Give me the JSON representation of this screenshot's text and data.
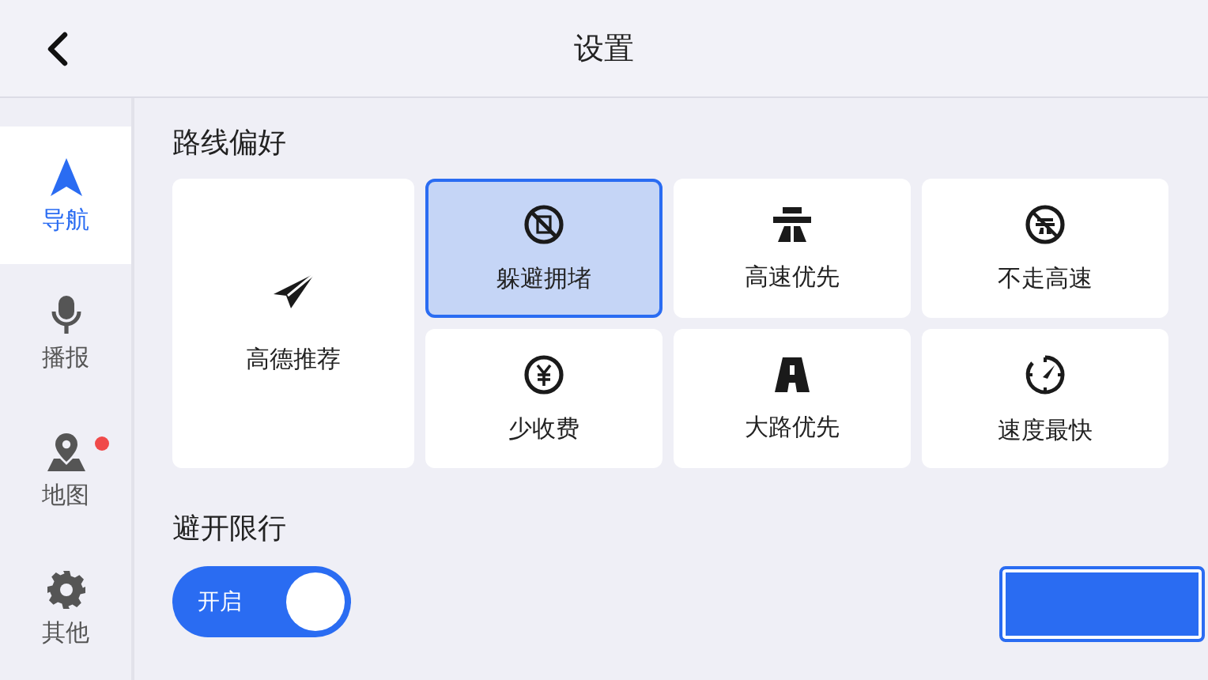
{
  "header": {
    "title": "设置"
  },
  "sidebar": {
    "items": [
      {
        "label": "导航",
        "selected": true,
        "badge": false
      },
      {
        "label": "播报",
        "selected": false,
        "badge": false
      },
      {
        "label": "地图",
        "selected": false,
        "badge": true
      },
      {
        "label": "其他",
        "selected": false,
        "badge": false
      }
    ]
  },
  "route_preferences": {
    "title": "路线偏好",
    "options": [
      {
        "label": "高德推荐",
        "selected": false
      },
      {
        "label": "躲避拥堵",
        "selected": true
      },
      {
        "label": "高速优先",
        "selected": false
      },
      {
        "label": "不走高速",
        "selected": false
      },
      {
        "label": "少收费",
        "selected": false
      },
      {
        "label": "大路优先",
        "selected": false
      },
      {
        "label": "速度最快",
        "selected": false
      }
    ]
  },
  "restriction": {
    "title": "避开限行",
    "toggle": {
      "label": "开启",
      "on": true
    }
  }
}
